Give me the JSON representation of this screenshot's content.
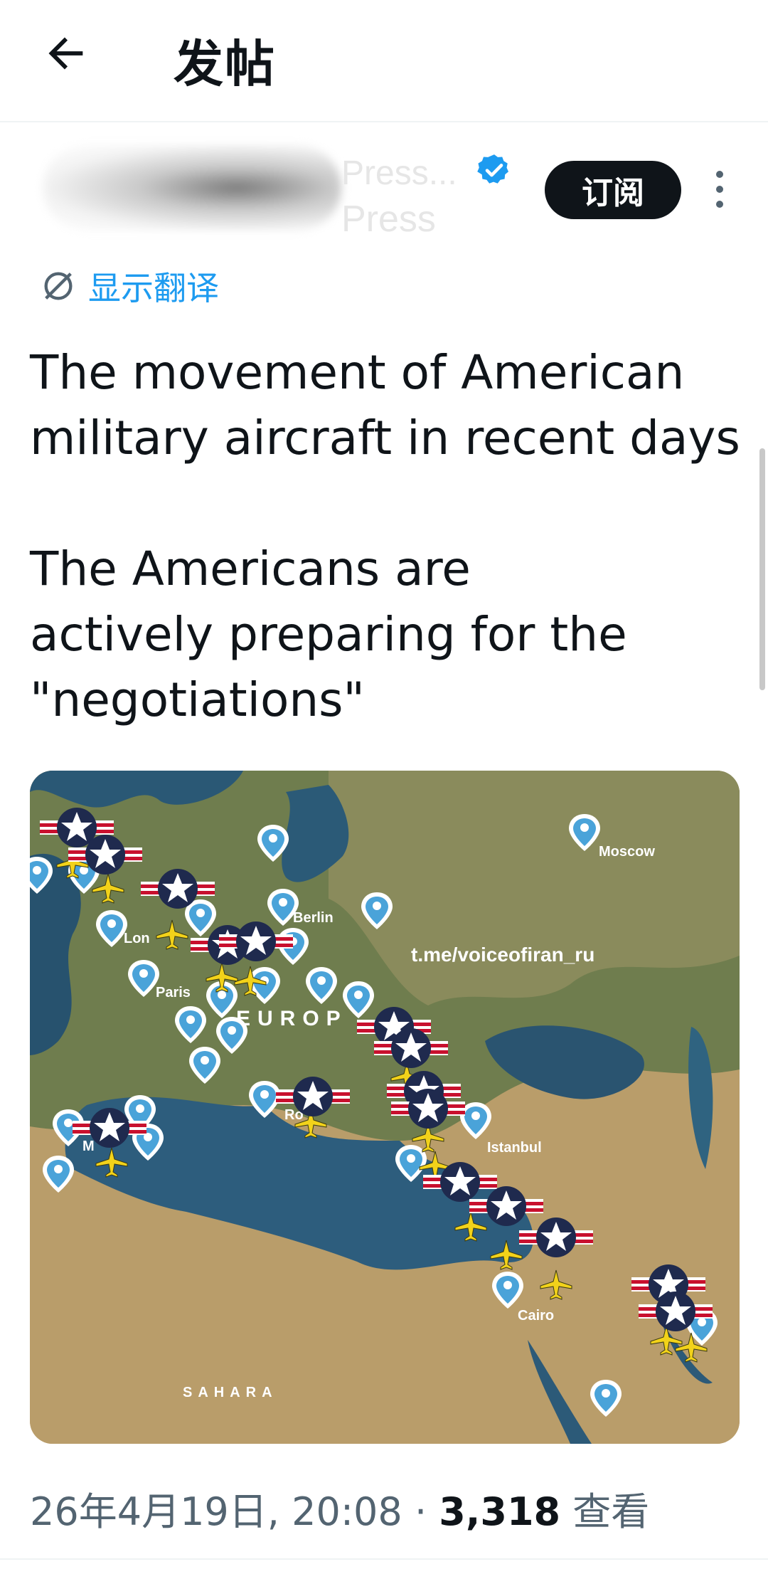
{
  "header": {
    "title": "发帖",
    "back_icon": "arrow-left-icon"
  },
  "author": {
    "name_fragment": "Press...",
    "handle_fragment": "Press",
    "verified_icon": "verified-badge-icon"
  },
  "subscribe_label": "订阅",
  "translate": {
    "label": "显示翻译",
    "icon": "translate-icon"
  },
  "tweet_text": "The movement of American\nmilitary aircraft in recent days\n\nThe Americans are\nactively preparing for the\n\"negotiations\"",
  "map": {
    "watermark": "t.me/voiceofiran_ru",
    "labels": {
      "moscow": "Moscow",
      "berlin": "Berlin",
      "london": "Lon",
      "paris": "Paris",
      "europe": "EUROP",
      "rome": "Ro",
      "madrid": "M",
      "istanbul": "Istanbul",
      "cairo": "Cairo",
      "sahara": "SAHARA"
    }
  },
  "meta": {
    "date": "26年4月19日",
    "time": "20:08",
    "separator": "·",
    "views_count": "3,318",
    "views_label": "查看"
  },
  "colors": {
    "accent": "#1d9bf0",
    "text": "#0f1419",
    "secondary": "#536471"
  }
}
